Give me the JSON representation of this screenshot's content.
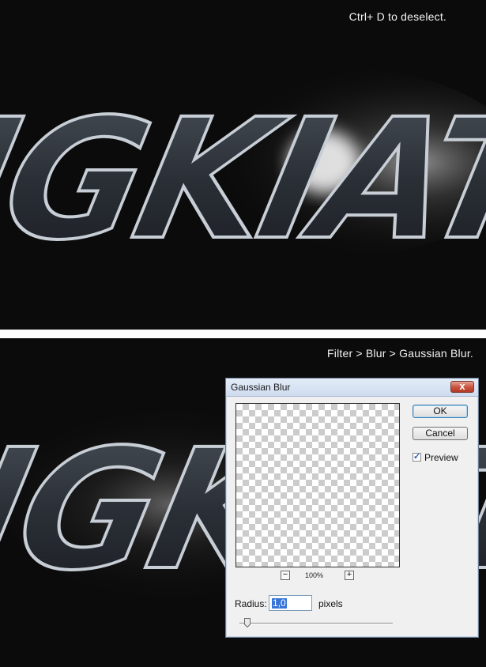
{
  "steps": [
    {
      "caption": "Ctrl+ D to deselect."
    },
    {
      "caption": "Filter > Blur > Gaussian Blur."
    }
  ],
  "artwork": {
    "text": "NGKIAT"
  },
  "dialog": {
    "title": "Gaussian Blur",
    "close_glyph": "x",
    "ok_label": "OK",
    "cancel_label": "Cancel",
    "preview_label": "Preview",
    "preview_checked": true,
    "check_glyph": "✓",
    "zoom_out_glyph": "−",
    "zoom_in_glyph": "+",
    "zoom_level": "100%",
    "radius_label": "Radius:",
    "radius_value": "1,0",
    "radius_units": "pixels",
    "slider_position": 0.05
  },
  "colors": {
    "background": "#0b0b0b",
    "separator": "#ffffff",
    "caption": "#f2f2f2",
    "chrome_text": "#c8ced6",
    "selection": "#3875d7"
  }
}
